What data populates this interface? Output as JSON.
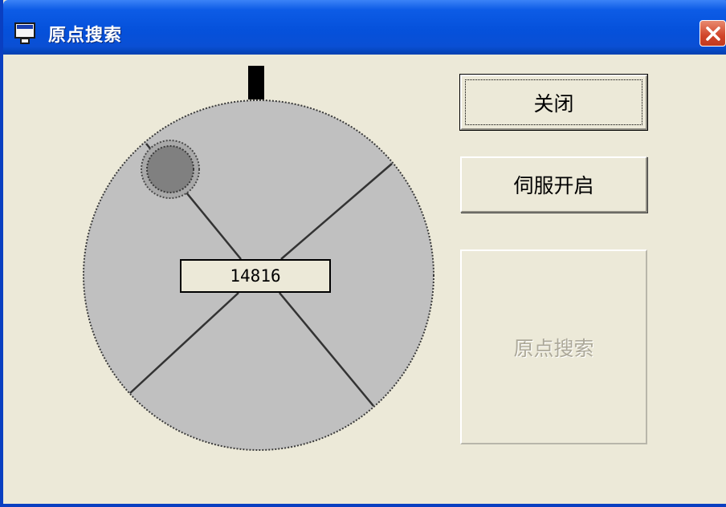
{
  "window": {
    "title": "原点搜索",
    "icons": {
      "app": "app-window-icon",
      "close": "close-x-icon"
    }
  },
  "buttons": {
    "close_label": "关闭",
    "servo_label": "伺服开启",
    "home_search_label": "原点搜索"
  },
  "dial": {
    "value": "14816",
    "colors": {
      "face": "#c0c0c0",
      "marker": "#808080",
      "pointer": "#000000"
    }
  },
  "colors": {
    "titlebar": "#0551db",
    "window_bg": "#ece9d8",
    "close_button": "#d1452a",
    "disabled_text": "#aca899"
  }
}
